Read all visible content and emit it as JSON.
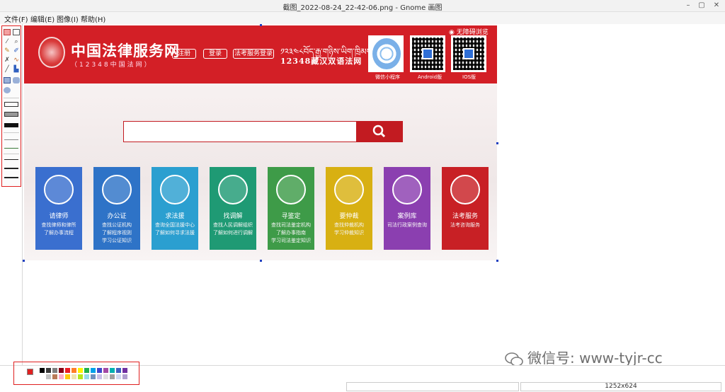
{
  "window": {
    "title": "截图_2022-08-24_22-42-06.png - Gnome 画图",
    "minimize": "–",
    "maximize": "▢",
    "close": "✕"
  },
  "menu": [
    "文件(F)",
    "编辑(E)",
    "图像(I)",
    "帮助(H)"
  ],
  "site": {
    "name": "中国法律服务网",
    "subtitle": "（12348中国法网）",
    "buttons": [
      "注册",
      "登录",
      "法考服务登录"
    ],
    "tibetan": "༡༢༣༤༨བོད་རྒྱ་གཉིས་ཡིག་ཁྲིམས་དྲ",
    "zangcn": "12348藏汉双语法网",
    "accessibility": "无障碍浏览",
    "qrcodes": [
      {
        "label": "微信小程序",
        "icon": "mini-program-qr"
      },
      {
        "label": "Android版",
        "icon": "android-qr"
      },
      {
        "label": "IOS版",
        "icon": "ios-qr"
      }
    ],
    "search": {
      "placeholder": "",
      "button_icon": "search-icon"
    },
    "cards": [
      {
        "title": "请律师",
        "desc": "查找律师和律所\n了解办事流程",
        "color": "#3a6fcf",
        "icon": "lawyer-badge-icon"
      },
      {
        "title": "办公证",
        "desc": "查找公证机构\n了解程序视则\n学习公证知识",
        "color": "#2e73c7",
        "icon": "notary-emblem-icon"
      },
      {
        "title": "求法援",
        "desc": "查询全国法援中心\n了解如何寻求法援",
        "color": "#2b9fd0",
        "icon": "legal-aid-icon"
      },
      {
        "title": "找调解",
        "desc": "查找人民调解组织\n了解如何进行调解",
        "color": "#1f9a74",
        "icon": "mediation-icon"
      },
      {
        "title": "寻鉴定",
        "desc": "查找司法鉴定机构\n了解办事指南\n学习司法鉴定知识",
        "color": "#3e9b48",
        "icon": "appraisal-icon"
      },
      {
        "title": "要仲裁",
        "desc": "查找仲裁机构\n学习仲裁知识",
        "color": "#d8b012",
        "icon": "arbitration-icon"
      },
      {
        "title": "案例库",
        "desc": "司法行政案例查询",
        "color": "#8b3fb0",
        "icon": "case-library-icon"
      },
      {
        "title": "法考服务",
        "desc": "法考咨询服务",
        "color": "#c82025",
        "icon": "law-exam-icon"
      }
    ]
  },
  "status": {
    "size": "1252x624"
  },
  "watermark": {
    "text": "微信号: www-tyjr-cc",
    "icon": "wechat-icon"
  },
  "palette": {
    "foreground": "#e02020",
    "background": "#ffffff",
    "top": [
      "#000000",
      "#3a3a3a",
      "#7f7f7f",
      "#880015",
      "#ed1c24",
      "#ff7f27",
      "#fff200",
      "#22b14c",
      "#00a2e8",
      "#3f48cc",
      "#a349a4",
      "#00b0b0",
      "#4060c0",
      "#7030a0"
    ],
    "bottom": [
      "#ffffff",
      "#c3c3c3",
      "#b97a57",
      "#ffaec9",
      "#ffc90e",
      "#efe4b0",
      "#b5e61d",
      "#99d9ea",
      "#7092be",
      "#c8bfe7",
      "#e0e0e0",
      "#a0a0a0",
      "#d0d8f0",
      "#b0a0d0"
    ]
  }
}
